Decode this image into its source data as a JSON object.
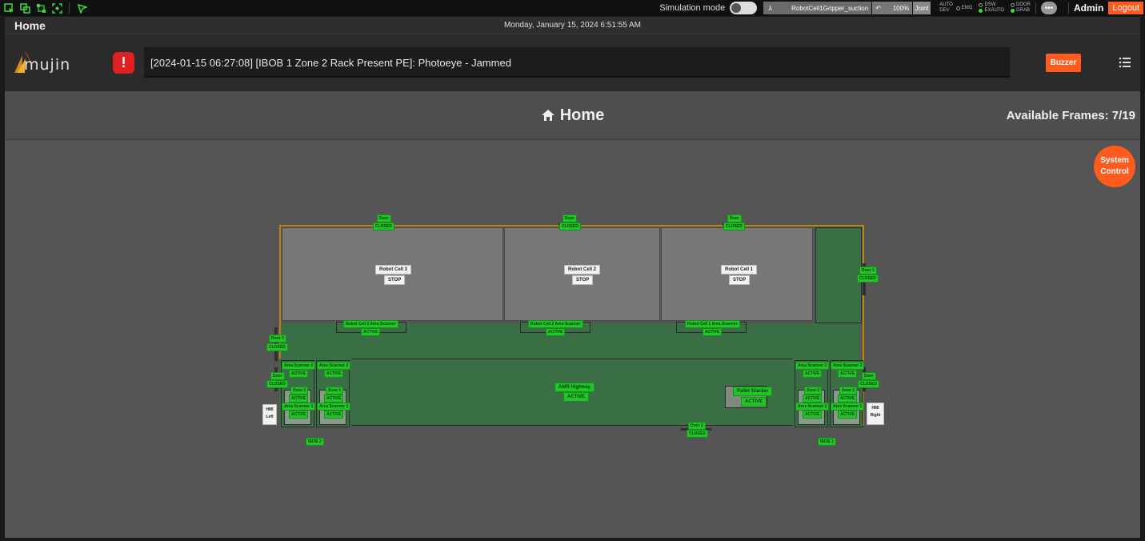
{
  "topbar": {
    "simulation_label": "Simulation mode",
    "robot_name": "RobotCell1Gripper_suction",
    "speed": "100%",
    "joint": "Joint",
    "modes": {
      "auto": "AUTO",
      "dev": "DEV"
    },
    "indicators": [
      {
        "label": "EMG",
        "on": false
      },
      {
        "label": "DSW",
        "on": false
      },
      {
        "label": "EXAUTO",
        "on": true
      },
      {
        "label": "DOOR",
        "on": false
      },
      {
        "label": "GRAB",
        "on": true
      }
    ],
    "more": "•••",
    "user": "Admin",
    "logout_label": "Logout"
  },
  "pagebar": {
    "title": "Home",
    "datetime": "Monday, January 15, 2024 6:51:55 AM"
  },
  "header": {
    "logo_text": "mujin",
    "alarm_message": "[2024-01-15 06:27:08] [IBOB 1 Zone 2 Rack Present PE]: Photoeye - Jammed",
    "buzzer_label": "Buzzer"
  },
  "main": {
    "title": "Home",
    "available_frames": "Available Frames: 7/19",
    "system_control": "System Control"
  },
  "layout": {
    "doors_top": [
      {
        "name": "Door",
        "state": "CLOSED"
      },
      {
        "name": "Door",
        "state": "CLOSED"
      },
      {
        "name": "Door",
        "state": "CLOSED"
      }
    ],
    "cells": [
      {
        "name": "Robot Cell 3",
        "state": "STOP"
      },
      {
        "name": "Robot Cell 2",
        "state": "STOP"
      },
      {
        "name": "Robot Cell 1",
        "state": "STOP"
      }
    ],
    "scanners": [
      {
        "name": "Robot Cell 3 Area Scanner",
        "state": "ACTIVE"
      },
      {
        "name": "Robot Cell 2 Area Scanner",
        "state": "ACTIVE"
      },
      {
        "name": "Robot Cell 1 Area Scanner",
        "state": "ACTIVE"
      }
    ],
    "door1": {
      "name": "Door 1",
      "state": "CLOSED"
    },
    "door2": {
      "name": "Door 2",
      "state": "CLOSED"
    },
    "door3": {
      "name": "Door 3",
      "state": "CLOSED"
    },
    "door_left": {
      "name": "Door",
      "state": "CLOSED"
    },
    "door_right": {
      "name": "Door",
      "state": "CLOSED"
    },
    "amr": {
      "name": "AMR Highway",
      "state": "ACTIVE"
    },
    "pallet": {
      "name": "Pallet Stacker",
      "state": "ACTIVE"
    },
    "area_scanner_2": "Area Scanner 2",
    "area_scanner_1": "Area Scanner 1",
    "zone_2": "Zone 2",
    "zone_1": "Zone 1",
    "active": "ACTIVE",
    "hmi_left": {
      "line1": "HMI",
      "line2": "Left"
    },
    "hmi_right": {
      "line1": "HMI",
      "line2": "Right"
    },
    "ibob2": "IBOB 2",
    "ibob1": "IBOB 1"
  },
  "colors": {
    "accent": "#ff5a1f",
    "status_green": "#22c42a",
    "alarm_red": "#e02020"
  }
}
